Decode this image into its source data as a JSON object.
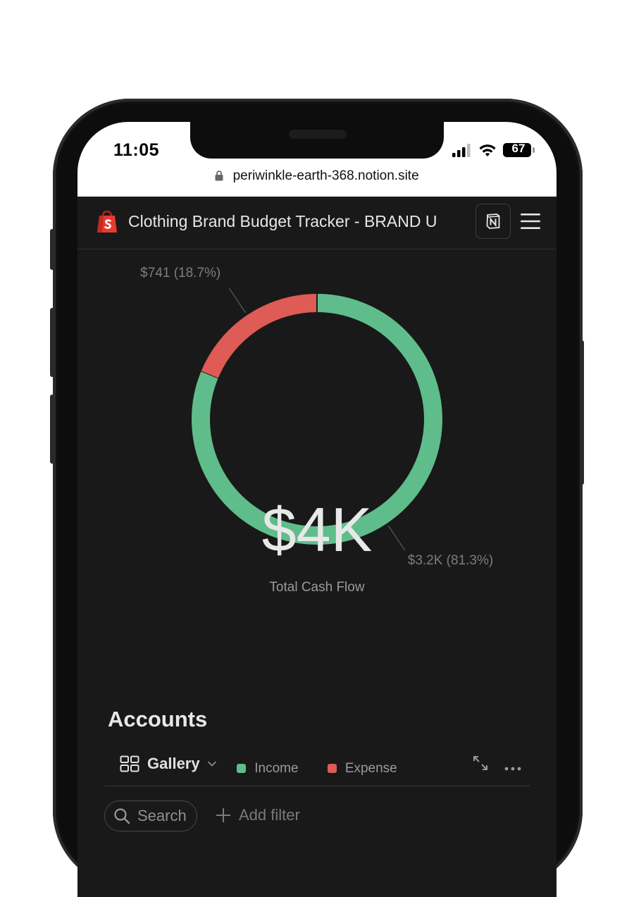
{
  "status_bar": {
    "time": "11:05",
    "battery": "67"
  },
  "browser": {
    "url": "periwinkle-earth-368.notion.site"
  },
  "header": {
    "title": "Clothing Brand Budget Tracker - BRAND U"
  },
  "chart_data": {
    "type": "pie",
    "center_value": "$4K",
    "center_label": "Total Cash Flow",
    "slices": [
      {
        "name": "Income",
        "value": 3200,
        "percent": 81.3,
        "label": "$3.2K (81.3%)",
        "color": "#5fbd8b"
      },
      {
        "name": "Expense",
        "value": 741,
        "percent": 18.7,
        "label": "$741 (18.7%)",
        "color": "#df5b56"
      }
    ],
    "legend": [
      "Income",
      "Expense"
    ],
    "legend_placement": "bottom"
  },
  "accounts": {
    "title": "Accounts",
    "view_label": "Gallery",
    "search_label": "Search",
    "add_filter_label": "Add filter"
  },
  "colors": {
    "background": "#191919",
    "income": "#5fbd8b",
    "expense": "#df5b56"
  }
}
